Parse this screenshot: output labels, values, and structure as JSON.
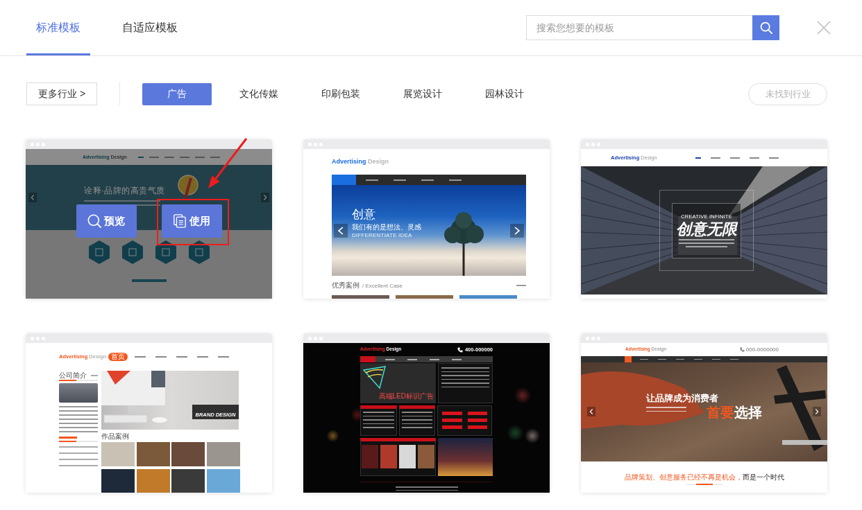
{
  "tabs": [
    {
      "label": "标准模板",
      "selected": true
    },
    {
      "label": "自适应模板",
      "selected": false
    }
  ],
  "search": {
    "placeholder": "搜索您想要的模板"
  },
  "filters": {
    "more_button": {
      "label": "更多行业 >"
    },
    "categories": [
      {
        "label": "广告",
        "selected": true
      },
      {
        "label": "文化传媒",
        "selected": false
      },
      {
        "label": "印刷包装",
        "selected": false
      },
      {
        "label": "展览设计",
        "selected": false
      },
      {
        "label": "园林设计",
        "selected": false
      }
    ],
    "not_found_button": {
      "label": "未找到行业",
      "disabled": true
    }
  },
  "templates": [
    {
      "kind": "teal",
      "hovered": true,
      "logo": {
        "brand": "Advertising",
        "suffix": "Design"
      },
      "headline": "诠释·品牌的高贵气质",
      "actions": [
        {
          "label": "预览",
          "kind": "preview",
          "highlighted": false
        },
        {
          "label": "使用",
          "kind": "use",
          "highlighted": true
        }
      ]
    },
    {
      "kind": "sky",
      "hovered": false,
      "logo": {
        "brand": "Advertising",
        "suffix": "Design"
      },
      "headline": "创意",
      "subline": "我们有的是想法、灵感",
      "tagline": "DIFFERENTIATE IDEA",
      "section": {
        "title": "优秀案例",
        "subtitle": "/ Excellent Case"
      }
    },
    {
      "kind": "corridor",
      "hovered": false,
      "logo": {
        "brand": "Advertising",
        "suffix": "Design"
      },
      "overline": "CREATIVE INFINITE",
      "headline": "创意无限"
    },
    {
      "kind": "brand",
      "hovered": false,
      "logo": {
        "brand": "Advertising",
        "suffix": "Design"
      },
      "nav_active": "首页",
      "sidebar_title": "公司简介",
      "banner_text": "BRAND DESIGN",
      "section_title": "作品案例"
    },
    {
      "kind": "dark",
      "hovered": false,
      "logo": {
        "brand": "Advertising",
        "suffix": "Design"
      },
      "phone": "400-000000",
      "banner_text": "高端LED标识广告"
    },
    {
      "kind": "workshop",
      "hovered": false,
      "logo": {
        "brand": "Advertising",
        "suffix": "Design"
      },
      "phone": "000-0000000",
      "headline": "让品牌成为消费者",
      "slogan": {
        "highlight": "首要",
        "rest": "选择"
      },
      "footer_line": {
        "highlight": "品牌策划、创意服务已经不再是机会，",
        "rest": "而是一个时代"
      }
    }
  ]
}
